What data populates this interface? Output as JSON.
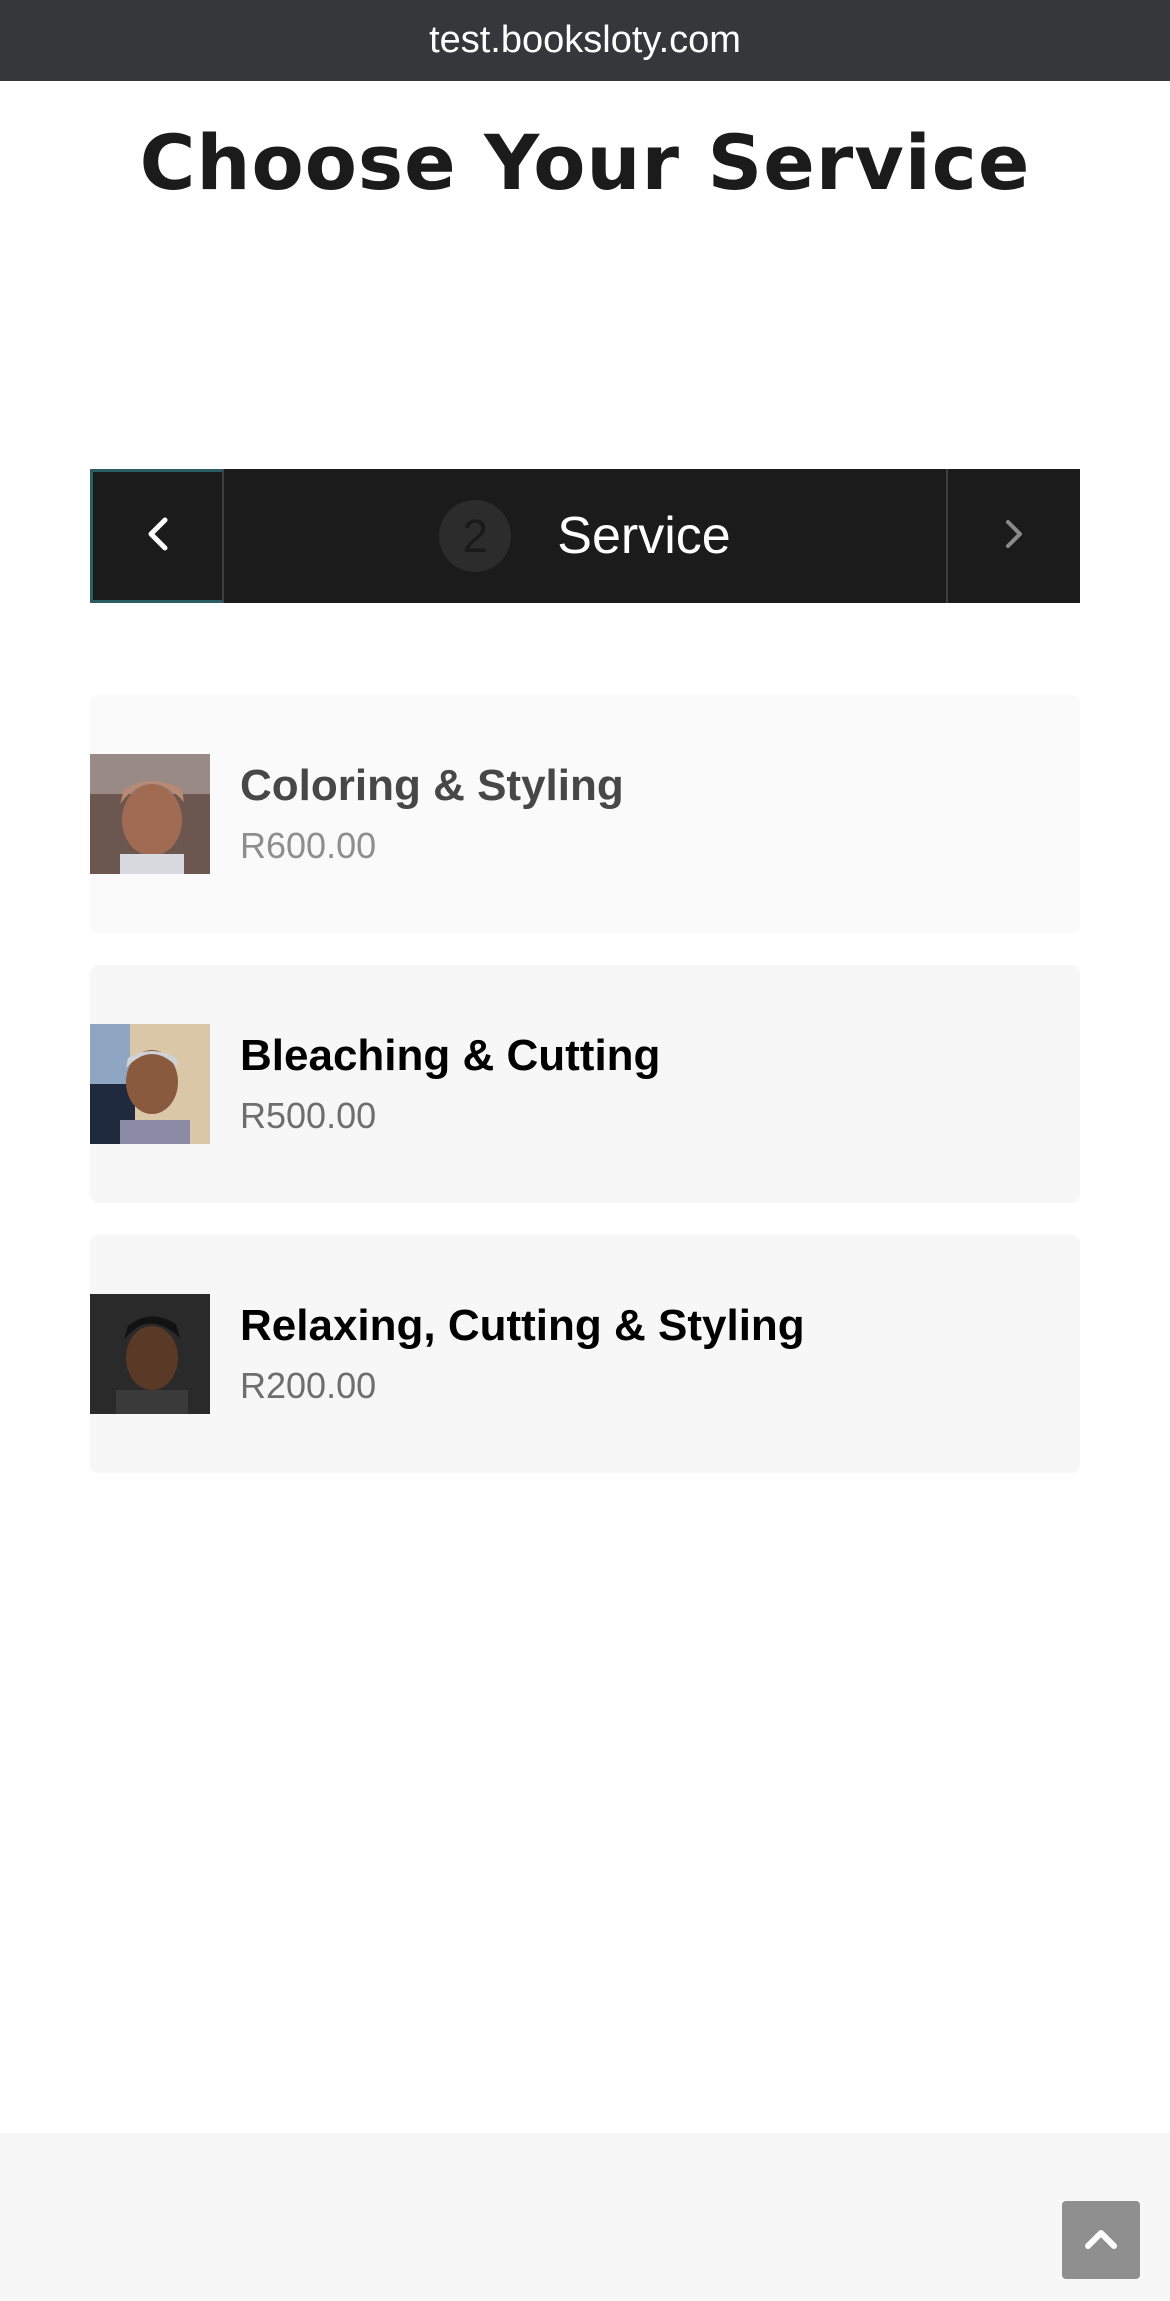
{
  "browser": {
    "url": "test.booksloty.com"
  },
  "page": {
    "title": "Choose Your Service"
  },
  "step_nav": {
    "prev_icon": "chevron-left-icon",
    "step_number": "2",
    "step_label": "Service",
    "next_icon": "chevron-right-icon"
  },
  "services": [
    {
      "name": "Coloring & Styling",
      "price": "R600.00",
      "image": "service-photo"
    },
    {
      "name": "Bleaching & Cutting",
      "price": "R500.00",
      "image": "service-photo"
    },
    {
      "name": "Relaxing, Cutting & Styling",
      "price": "R200.00",
      "image": "service-photo"
    }
  ],
  "footer": {
    "scroll_top_icon": "chevron-up-icon"
  },
  "colors": {
    "url_bar": "#35373a",
    "step_nav_bg": "#1c1b1c",
    "card_bg": "#f7f7f7",
    "scroll_top_bg": "#8f8f8f"
  }
}
